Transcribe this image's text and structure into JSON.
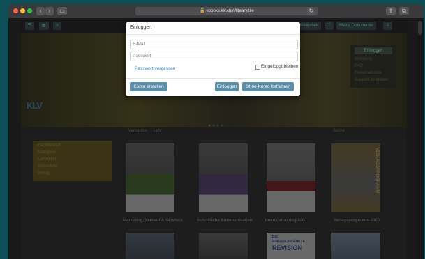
{
  "browser": {
    "url": "ebooks.klv.ch/#/library/tile"
  },
  "site": {
    "brand": "KLV",
    "nav": {
      "item1": "Bibliothek",
      "item2": "Meine Dokumente"
    },
    "dropdown": {
      "header": "Einloggen",
      "items": [
        "Anleitung",
        "FAQ",
        "Freischaltcode",
        "Support schreiben"
      ]
    },
    "tabs": {
      "left": "Verkaufen",
      "left2": "Lehr",
      "right": "Suche"
    },
    "sidebar": {
      "items": [
        "Fachbereich",
        "Kategorie",
        "Lehrmittel",
        "Schulstufe",
        "Verlag"
      ]
    },
    "books": [
      {
        "title": "Marketing, Verkauf & Services"
      },
      {
        "title": "Schriftliche Kommunikation"
      },
      {
        "title": "Intensivtraining ABU"
      },
      {
        "title": "Verlagsprogramm 2020"
      }
    ],
    "row2_book_text": {
      "book3_line1": "DIE",
      "book3_line2": "EINGESCHRÄNKTE",
      "book3_line3": "REVISION"
    },
    "verlag_vertical": "VERLAGSPROGRAMM"
  },
  "modal": {
    "title": "Einloggen",
    "email_placeholder": "E-Mail",
    "password_placeholder": "Passwort",
    "forgot_link": "Passwort vergessen",
    "remember_label": "Eingeloggt bleiben",
    "create_button": "Konto erstellen",
    "login_button": "Einloggen",
    "guest_button": "Ohne Konto fortfahren"
  }
}
